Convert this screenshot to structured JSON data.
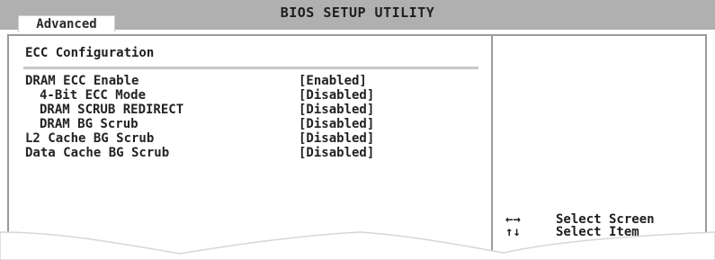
{
  "header": {
    "title": "BIOS SETUP UTILITY",
    "active_tab": "Advanced"
  },
  "section": {
    "title": "ECC Configuration"
  },
  "settings": [
    {
      "label": "DRAM ECC Enable",
      "value": "[Enabled]"
    },
    {
      "label": "4-Bit ECC Mode",
      "value": "[Disabled]"
    },
    {
      "label": "DRAM SCRUB REDIRECT",
      "value": "[Disabled]"
    },
    {
      "label": "DRAM BG Scrub",
      "value": "[Disabled]"
    },
    {
      "label": "L2 Cache BG Scrub",
      "value": "[Disabled]"
    },
    {
      "label": "Data Cache BG Scrub",
      "value": "[Disabled]"
    }
  ],
  "help": {
    "items": [
      {
        "keys": "←→",
        "text": "Select Screen",
        "icon": "left-right-arrows-icon"
      },
      {
        "keys": "↑↓",
        "text": "Select Item",
        "icon": "up-down-arrows-icon"
      }
    ]
  },
  "colors": {
    "header_bg": "#b0b0b0",
    "frame": "#9a9a9a",
    "text": "#1e1e1e",
    "background": "#ffffff"
  }
}
